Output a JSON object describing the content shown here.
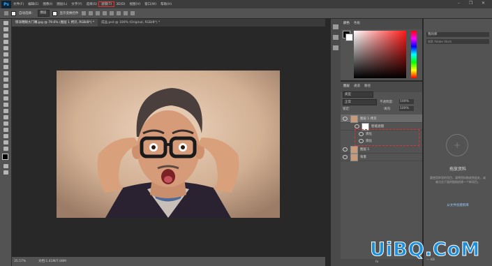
{
  "menubar": {
    "logo": "Ps",
    "items": [
      "文件(F)",
      "编辑(E)",
      "图像(I)",
      "图层(L)",
      "文字(Y)",
      "选择(S)",
      "滤镜(T)",
      "3D(D)",
      "视图(V)",
      "窗口(W)",
      "帮助(H)"
    ],
    "active_index": 6,
    "window_controls": [
      "–",
      "❐",
      "✕"
    ]
  },
  "options_bar": {
    "auto_select_label": "自动选择：",
    "auto_select_value": "图层",
    "show_transform_label": "显示变换控件"
  },
  "tabs": [
    {
      "label": "惊讶瞪眼大门嘴.jpg @ 79.6% (图层 1 拷贝, RGB/8*) *",
      "active": true
    },
    {
      "label": "成品.psd @ 100% (Original, RGB/8*) *",
      "active": false
    }
  ],
  "status": {
    "zoom": "35.57%",
    "doc": "文档:1.41M/7.08M"
  },
  "color_panel": {
    "tabs": [
      "颜色",
      "色板"
    ]
  },
  "layers_panel": {
    "tabs": [
      "图层",
      "通道",
      "路径"
    ],
    "filter_kind": "类型",
    "blend_mode": "正常",
    "opacity_label": "不透明度:",
    "opacity_value": "100%",
    "lock_label": "锁定:",
    "fill_label": "填充:",
    "fill_value": "100%",
    "layers": [
      {
        "name": "图层 1 拷贝",
        "kind": "smart",
        "selected": true
      },
      {
        "name": "智能滤镜",
        "kind": "smart-filter"
      },
      {
        "name": "液化",
        "kind": "filter"
      },
      {
        "name": "液化",
        "kind": "filter"
      },
      {
        "name": "图层 1",
        "kind": "normal"
      },
      {
        "name": "背景",
        "kind": "background"
      }
    ],
    "fx_label": "fx"
  },
  "library_panel": {
    "dropdown": "我的库",
    "search_placeholder": "搜索 Adobe Stock",
    "title": "拖放资料",
    "description": "要使用库里的项目，请将资料拖放到此处，或者点击下面的链接创建一个新项目。",
    "link": "从文件创建新库",
    "kb": "— KB"
  },
  "watermark": "UiBQ.CoM",
  "colors": {
    "accent_red": "#e53030",
    "watermark_blue": "#1e8fdd"
  }
}
